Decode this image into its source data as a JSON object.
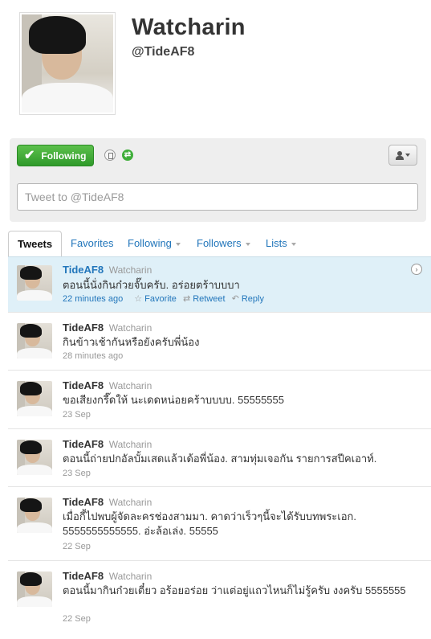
{
  "profile": {
    "name": "Watcharin",
    "handle": "@TideAF8"
  },
  "actions": {
    "follow_label": "Following",
    "tweet_placeholder": "Tweet to @TideAF8"
  },
  "tabs": [
    {
      "label": "Tweets"
    },
    {
      "label": "Favorites"
    },
    {
      "label": "Following"
    },
    {
      "label": "Followers"
    },
    {
      "label": "Lists"
    }
  ],
  "tweet_actions": {
    "favorite": "Favorite",
    "retweet": "Retweet",
    "reply": "Reply"
  },
  "tweets": [
    {
      "user": "TideAF8",
      "fullname": "Watcharin",
      "text": "ตอนนี้นั่งกินก๋วยจั๊บครับ. อร่อยตร้าบบบา",
      "time": "22 minutes ago"
    },
    {
      "user": "TideAF8",
      "fullname": "Watcharin",
      "text": "กินข้าวเช้ากันหรือยังครับพี่น้อง",
      "time": "28 minutes ago"
    },
    {
      "user": "TideAF8",
      "fullname": "Watcharin",
      "text": "ขอเสียงกรี๊ดให้ นะเดดหน่อยคร้าบบบบ. 55555555",
      "time": "23 Sep"
    },
    {
      "user": "TideAF8",
      "fullname": "Watcharin",
      "text": "ตอนนี้ถ่ายปกอัลบั้มเสดแล้วเด้อพี่น้อง. สามทุ่มเจอกัน รายการสปีคเอาท์.",
      "time": "23 Sep"
    },
    {
      "user": "TideAF8",
      "fullname": "Watcharin",
      "text": "เมื่อกี้ไปพบผู้จัดละครช่องสามมา. คาดว่าเร็วๆนี้จะได้รับบทพระเอก. 5555555555555. อ่ะล้อเล่ง. 55555",
      "time": "22 Sep"
    },
    {
      "user": "TideAF8",
      "fullname": "Watcharin",
      "text": "ตอนนี้มากินก๋วยเตี๋ยว อร้อยอร่อย ว่าแต่อยู่แถวไหนก็ไม่รู้ครับ งงครับ 5555555",
      "time": "22 Sep"
    }
  ]
}
